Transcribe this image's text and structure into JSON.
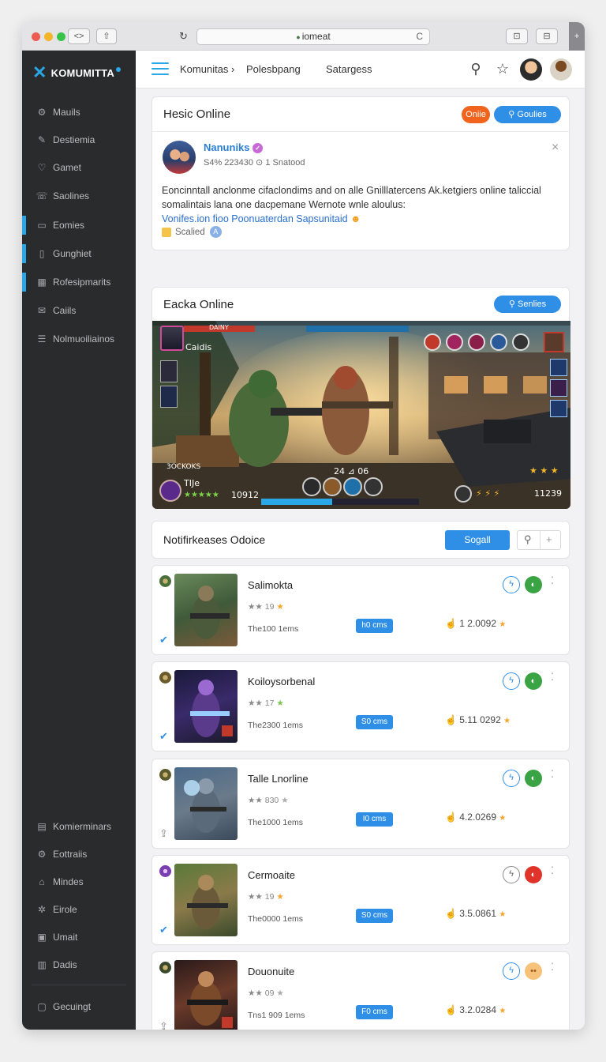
{
  "browser": {
    "url": "iomeat",
    "nav_arrows": "<>",
    "share_label": "⇧",
    "reload_label": "C",
    "tab_btn1": "⊡",
    "tab_btn2": "⊟",
    "new_tab": "+"
  },
  "sidebar": {
    "brand": "KOMUMITTA",
    "items": [
      {
        "label": "Mauils",
        "icon": "gear-icon",
        "active": false
      },
      {
        "label": "Destiemia",
        "icon": "pencil-icon",
        "active": false
      },
      {
        "label": "Gamet",
        "icon": "heart-icon",
        "active": false
      },
      {
        "label": "Saolines",
        "icon": "phone-icon",
        "active": false
      },
      {
        "label": "Eomies",
        "icon": "chat-icon",
        "active": true
      },
      {
        "label": "Gunghiet",
        "icon": "doc-icon",
        "active": true
      },
      {
        "label": "Rofesipmarits",
        "icon": "grid-icon",
        "active": true
      },
      {
        "label": "Caiils",
        "icon": "mail-icon",
        "active": false
      },
      {
        "label": "Nolmuoiliainos",
        "icon": "list-icon",
        "active": false
      }
    ],
    "bottom_items": [
      {
        "label": "Komierminars",
        "icon": "doc-icon"
      },
      {
        "label": "Eottraiis",
        "icon": "gear-icon"
      },
      {
        "label": "Mindes",
        "icon": "home-icon"
      },
      {
        "label": "Eirole",
        "icon": "settings-icon"
      },
      {
        "label": "Umait",
        "icon": "calendar-icon"
      },
      {
        "label": "Dadis",
        "icon": "chart-icon"
      }
    ],
    "footer_item": {
      "label": "Gecuingt",
      "icon": "window-icon"
    }
  },
  "topnav": {
    "links": [
      "Komunitas ›",
      "Polesbpang",
      "Satargess"
    ]
  },
  "post_card": {
    "title": "Hesic Online",
    "btn_orange": "Oniie",
    "btn_blue": "Goulies",
    "author": "Nanuniks",
    "meta": "S4% 223430 ⊙ 1 Snatood",
    "body_line1": "Eoncinntall anclonme cifaclondims and on alle Gnilllatercens Ak.ketgiers online taliccial",
    "body_line2": "somalintais lana one  dacpemane Wernote wnle aloulus:",
    "body_link": "Vonifes.ion fioo Poonuaterdan Sapsunitaid",
    "footer": "Scalied",
    "close": "×"
  },
  "game_card": {
    "title": "Eacka Online",
    "btn": "Senlies",
    "hud": {
      "player_tag": "Caidis",
      "top_label": "DAINY",
      "score_left": "3OCKOKS",
      "rank_label": "TIJe",
      "rating_num": "10912",
      "center_ammo": "24 ⊿ 06",
      "right_score": "11239"
    }
  },
  "notifications": {
    "title": "Notifirkeases Odoice",
    "btn": "Sogall",
    "search_icon": "⚲",
    "plus": "+"
  },
  "items": [
    {
      "name": "Salimokta",
      "rating": "19",
      "items_text": "The100 1ems",
      "tag": "h0 cms",
      "likes": "1 2.0092",
      "circle2_color": "#3aa444",
      "mini_color": "#4a6f3a",
      "verify": "✔",
      "verify_gray": false,
      "art": "green"
    },
    {
      "name": "Koiloysorbenal",
      "rating": "17",
      "items_text": "The2300 1ems",
      "tag": "S0 cms",
      "likes": "5.11 0292",
      "circle2_color": "#3aa444",
      "mini_color": "#6a5a2a",
      "verify": "✔",
      "verify_gray": false,
      "art": "purple"
    },
    {
      "name": "Talle Lnorline",
      "rating": "830",
      "items_text": "The1000 1ems",
      "tag": "I0 cms",
      "likes": "4.2.0269",
      "circle2_color": "#3aa444",
      "mini_color": "#5a5a2a",
      "verify": "⇪",
      "verify_gray": true,
      "art": "blue"
    },
    {
      "name": "Cermoaite",
      "rating": "19",
      "items_text": "The0000 1ems",
      "tag": "S0 cms",
      "likes": "3.5.0861",
      "circle2_color": "#e0342a",
      "mini_color": "#7a3fb0",
      "verify": "✔",
      "verify_gray": false,
      "art": "forest"
    },
    {
      "name": "Douonuite",
      "rating": "09",
      "items_text": "Tns1 909 1ems",
      "tag": "F0 cms",
      "likes": "3.2.0284",
      "circle2_color": "#f6c27a",
      "mini_color": "#3a4a2a",
      "verify": "⇪",
      "verify_gray": true,
      "art": "fire"
    }
  ]
}
